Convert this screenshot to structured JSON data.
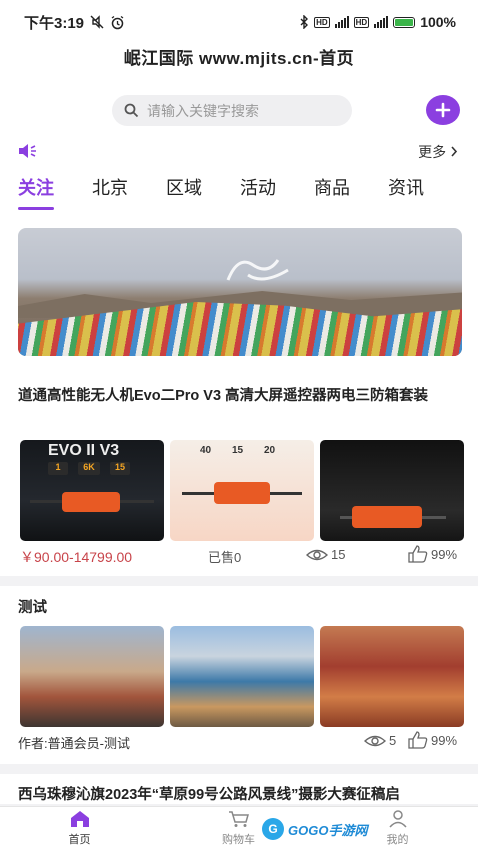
{
  "status_bar": {
    "time": "下午3:19",
    "battery": "100%",
    "network": "5G"
  },
  "header": {
    "title": "岷江国际  www.mjits.cn-首页"
  },
  "search": {
    "placeholder": "请输入关键字搜索"
  },
  "notice": {
    "more_label": "更多"
  },
  "tabs": [
    {
      "label": "关注",
      "active": true
    },
    {
      "label": "北京",
      "active": false
    },
    {
      "label": "区域",
      "active": false
    },
    {
      "label": "活动",
      "active": false
    },
    {
      "label": "商品",
      "active": false
    },
    {
      "label": "资讯",
      "active": false
    }
  ],
  "posts": [
    {
      "title": "道通高性能无人机Evo二Pro V3 高清大屏遥控器两电三防箱套装",
      "price": "￥90.00-14799.00",
      "sold": "已售0",
      "views": "15",
      "likes": "99%",
      "image_texts": {
        "p1_big": "EVO II V3",
        "p1_chips": [
          "1",
          "6K",
          "15"
        ],
        "p2_tags": [
          "40",
          "15",
          "20"
        ]
      }
    },
    {
      "title": "测试",
      "author": "作者:普通会员-测试",
      "views": "5",
      "likes": "99%"
    },
    {
      "title": "西乌珠穆沁旗2023年“草原99号公路风景线”摄影大赛征稿启"
    }
  ],
  "bottom_nav": [
    {
      "label": "首页",
      "active": true
    },
    {
      "label": "购物车",
      "active": false
    },
    {
      "label": "我的",
      "active": false
    }
  ],
  "watermark": {
    "text": "GOGO手游网"
  },
  "colors": {
    "accent": "#8b3fe0",
    "price": "#c8444a"
  }
}
